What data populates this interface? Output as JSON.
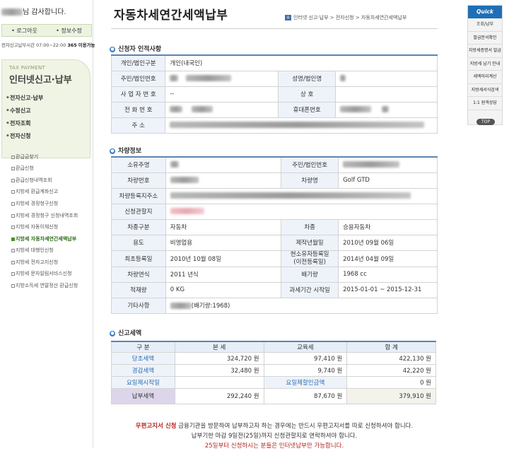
{
  "page_title": "자동차세연간세액납부",
  "breadcrumb": [
    "인터넷 신고·납부",
    "전자신청",
    "자동차세연간세액납부"
  ],
  "sidebar": {
    "greeting": "님 감사합니다.",
    "logout_label": "• 로그아웃",
    "info_edit_label": "• 정보수정",
    "hours_text": "전자신고납부시간 07:00~22:00",
    "hours_bold": "365 이용가능",
    "tax_payment_en": "TAX PAYMENT",
    "tax_payment_title": "인터넷신고·납부",
    "main_menu": [
      "전자신고·납부",
      "수정신고",
      "전자조회",
      "전자신청"
    ],
    "sub_menu": [
      "환급금찾기",
      "환급신청",
      "환급신청내역조회",
      "지방세 환급계좌신고",
      "지방세 경정청구신청",
      "지방세 경정청구 신청내역조회",
      "지방세 자동이체신청",
      "지방세 자동차세연간세액납부",
      "지방세 대행인신청",
      "지방세 전자고지신청",
      "지방세 문자알림서비스신청",
      "지방소득세 연말정산 환급신청"
    ],
    "active_index": 7
  },
  "applicant": {
    "section_title": "신청자 인적사항",
    "type_label": "개인/법인구분",
    "type_value": "개인(내국인)",
    "id_label": "주민/법인번호",
    "name_label": "성명/법인명",
    "biz_label": "사 업 자 번 호",
    "biz_value": "--",
    "trade_label": "상 호",
    "phone_label": "전 화 번 호",
    "mobile_label": "휴대폰번호",
    "address_label": "주 소"
  },
  "vehicle": {
    "section_title": "차량정보",
    "owner_label": "소유주명",
    "owner_id_label": "주민/법인번호",
    "plate_label": "차량번호",
    "model_label": "차량명",
    "model_value": "Golf GTD",
    "reg_address_label": "차량등록지주소",
    "office_label": "신청관할지",
    "class_label": "차종구분",
    "class_value": "자동차",
    "kind_label": "차종",
    "kind_value": "승용자동차",
    "use_label": "용도",
    "use_value": "비영업용",
    "made_label": "제작년월일",
    "made_value": "2010년 09월 06일",
    "first_reg_label": "최초등록일",
    "first_reg_value": "2010년 10월 08일",
    "owner_reg_label": "현소유자등록일\n(이전등록일)",
    "owner_reg_value": "2014년 04월 09일",
    "year_label": "차량연식",
    "year_value": "2011 년식",
    "cc_label": "배기량",
    "cc_value": "1968 cc",
    "load_label": "적재량",
    "load_value": "0 KG",
    "period_label": "과세기간 시작일",
    "period_value": "2015-01-01 ~ 2015-12-31",
    "etc_label": "기타사항",
    "etc_value": "(배기량:1968)"
  },
  "tax": {
    "section_title": "신고세액",
    "headers": [
      "구 분",
      "본 세",
      "교육세",
      "합 계"
    ],
    "rows": [
      {
        "label": "당초세액",
        "base": "324,720 원",
        "edu": "97,410 원",
        "total": "422,130 원"
      },
      {
        "label": "경감세액",
        "base": "32,480 원",
        "edu": "9,740 원",
        "total": "42,220 원"
      }
    ],
    "due_label": "요일제시작일",
    "due_discount_label": "요일제할인금액",
    "due_discount_value": "0 원",
    "final_label": "납부세액",
    "final_base": "292,240 원",
    "final_edu": "87,670 원",
    "final_total": "379,910 원"
  },
  "notice": {
    "red_part": "우편고지서 신청",
    "line1": " 금융기관을 방문하여 납부하고자 하는 경우에는 반드시 우편고지서를 따로 신청하셔야 합니다.",
    "line2": "납부기한 마감 9일전(25일)까지 신청관할지로 연락하셔야 합니다.",
    "line3": "25일부터 신청하시는 분들은 인터넷납부만 가능합니다."
  },
  "quick_menu": {
    "title": "Quick Menu",
    "items": [
      "조회/납부",
      "발급문서확인",
      "지방세증명서 발급",
      "지방세 납기 안내",
      "세액미리계산",
      "지방세서식검색",
      "1:1 원격상담"
    ],
    "top_label": "TOP"
  },
  "colors": {
    "accent": "#1f6fb6",
    "table_border": "#5b84b1",
    "notice_red": "#b5261e"
  }
}
